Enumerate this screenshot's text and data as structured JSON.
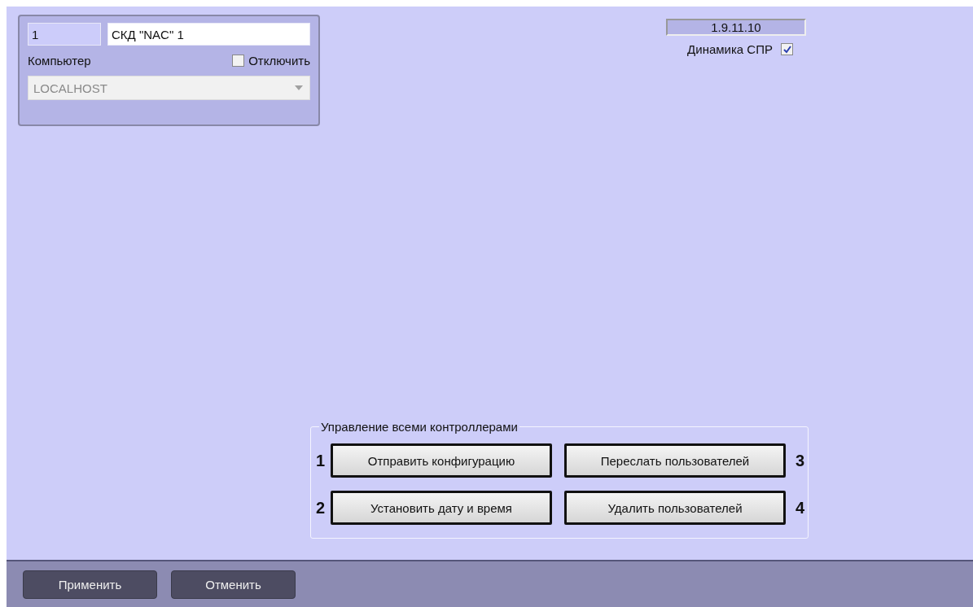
{
  "object_panel": {
    "id": "1",
    "name": "СКД \"NAC\" 1",
    "computer_label": "Компьютер",
    "disable": {
      "label": "Отключить",
      "checked": false
    },
    "computer": {
      "value": "LOCALHOST",
      "disabled": true
    }
  },
  "version": "1.9.11.10",
  "dynamics": {
    "label": "Динамика СПР",
    "checked": true
  },
  "controllers_group": {
    "title": "Управление всеми контроллерами",
    "buttons": [
      {
        "label": "Отправить конфигурацию",
        "marker": "1",
        "kind": "leftmark"
      },
      {
        "label": "Переслать пользователей",
        "marker": "3",
        "kind": "rightmark"
      },
      {
        "label": "Установить дату и время",
        "marker": "2",
        "kind": "leftmark"
      },
      {
        "label": "Удалить пользователей",
        "marker": "4",
        "kind": "rightmark"
      }
    ]
  },
  "footer_buttons": [
    "Применить",
    "Отменить"
  ]
}
